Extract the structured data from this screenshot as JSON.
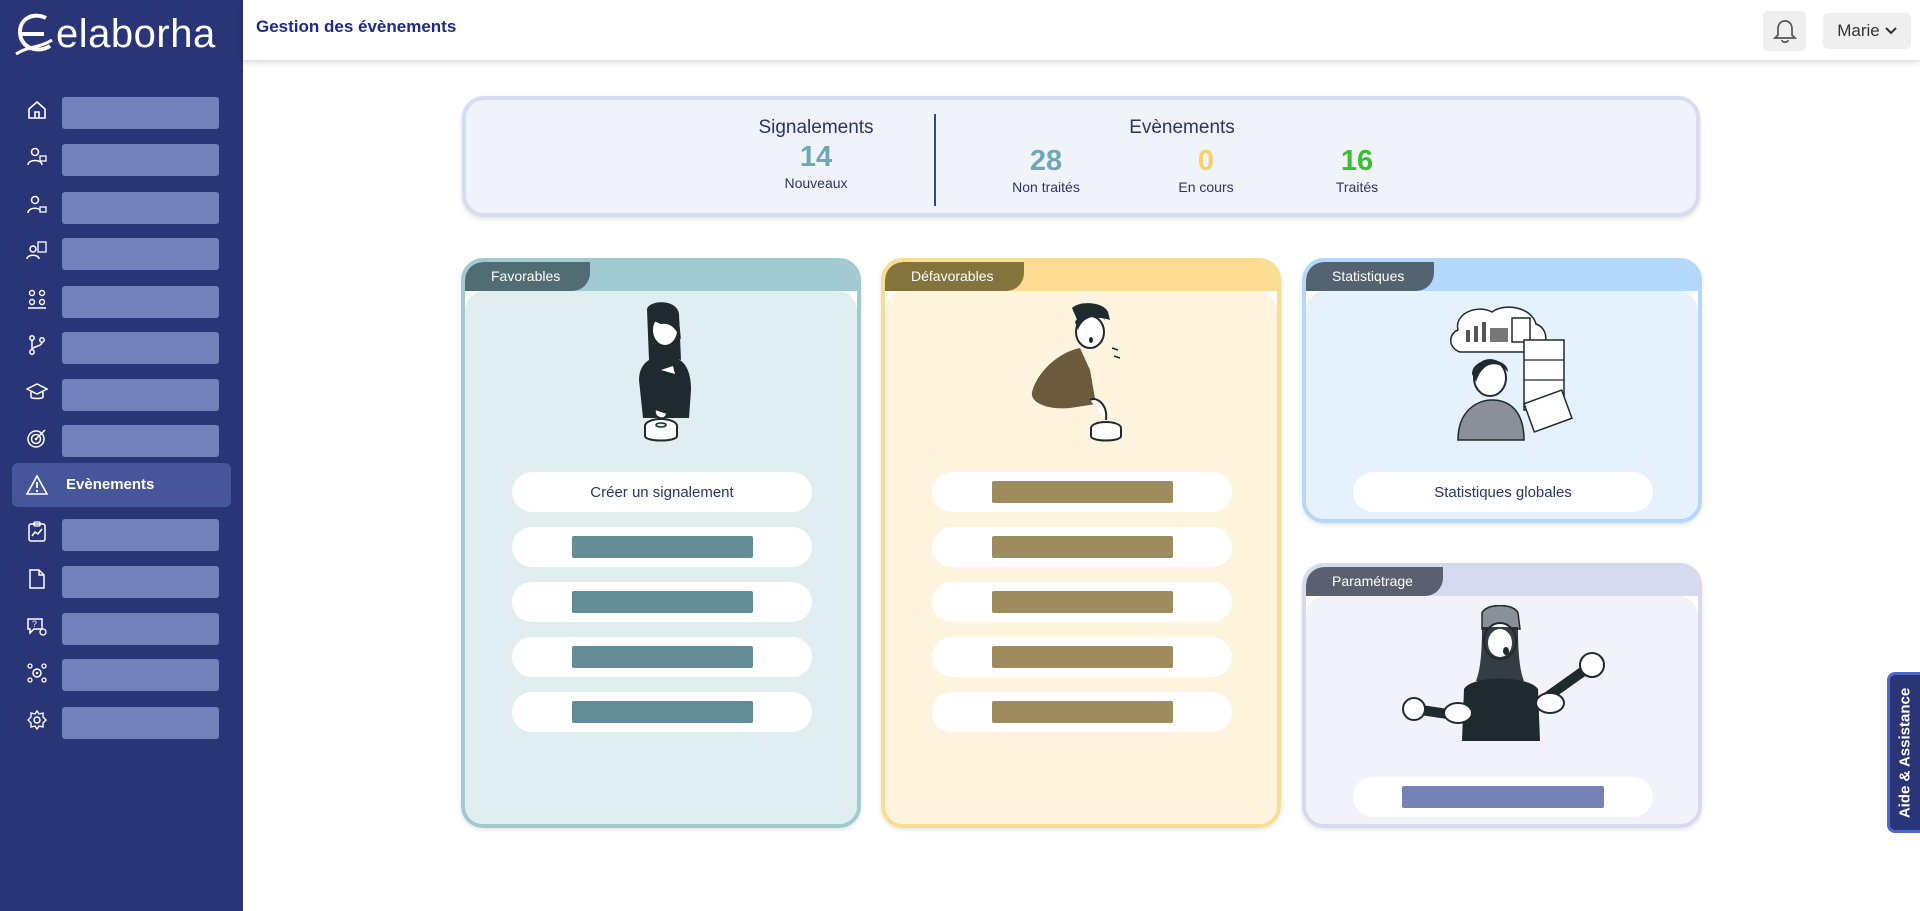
{
  "app": {
    "logo_text": "elaborha"
  },
  "header": {
    "title": "Gestion des évènements",
    "user": "Marie"
  },
  "sidebar": {
    "items": [
      {
        "icon": "home-icon"
      },
      {
        "icon": "user-settings-icon"
      },
      {
        "icon": "user-lock-icon"
      },
      {
        "icon": "user-document-icon"
      },
      {
        "icon": "team-icon"
      },
      {
        "icon": "branch-icon"
      },
      {
        "icon": "graduation-cap-icon"
      },
      {
        "icon": "target-icon"
      },
      {
        "icon": "warning-icon",
        "label": "Evènements",
        "active": true
      },
      {
        "icon": "chart-clipboard-icon"
      },
      {
        "icon": "file-icon"
      },
      {
        "icon": "help-chat-icon"
      },
      {
        "icon": "team-gear-icon"
      },
      {
        "icon": "gear-icon"
      }
    ]
  },
  "summary": {
    "signalements": {
      "heading": "Signalements",
      "value": "14",
      "label": "Nouveaux"
    },
    "evenements": {
      "heading": "Evènements",
      "items": [
        {
          "value": "28",
          "label": "Non traités",
          "color": "#6fa6b8"
        },
        {
          "value": "0",
          "label": "En cours",
          "color": "#f5cf6a"
        },
        {
          "value": "16",
          "label": "Traités",
          "color": "#3bbf2e"
        }
      ]
    }
  },
  "cards": {
    "favorables": {
      "tab": "Favorables",
      "create_label": "Créer un signalement"
    },
    "defavorables": {
      "tab": "Défavorables"
    },
    "statistiques": {
      "tab": "Statistiques",
      "button_label": "Statistiques globales"
    },
    "parametrage": {
      "tab": "Paramétrage"
    }
  },
  "colors": {
    "sidebar": "#2a3578",
    "favorables_tab": "#4f6d72",
    "favorables_bg": "#e1eef0",
    "favorables_border": "#a1c9d2",
    "favorables_bar": "#628d96",
    "defavorables_tab": "#83733d",
    "defavorables_bg": "#fef4de",
    "defavorables_border": "#fbdd92",
    "defavorables_bar": "#9f8c5e",
    "statistiques_tab": "#53636f",
    "statistiques_bg": "#e5f1fc",
    "statistiques_border": "#b3d8fb",
    "parametrage_tab": "#5b6070",
    "parametrage_bg": "#f1f2fa",
    "parametrage_border": "#d6daf1",
    "parametrage_bar": "#7482b8"
  },
  "aide": {
    "label": "Aide & Assistance"
  }
}
